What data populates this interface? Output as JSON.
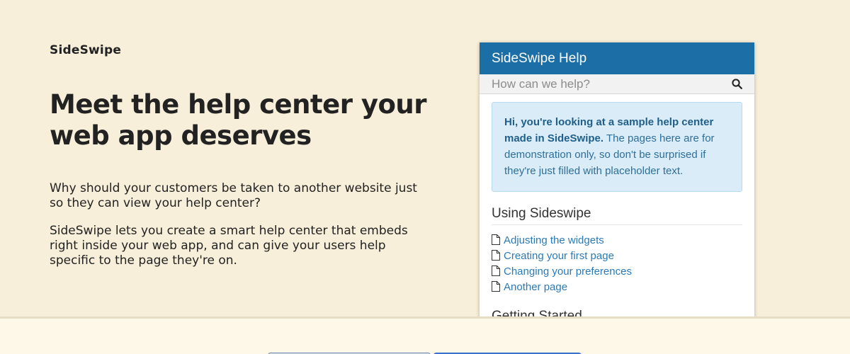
{
  "brand": "SideSwipe",
  "hero": {
    "title": "Meet the help center your web app deserves",
    "paragraph1": "Why should your customers be taken to another website just so they can view your help center?",
    "paragraph2": "SideSwipe lets you create a smart help center that embeds right inside your web app, and can give your users help specific to the page they're on."
  },
  "help_widget": {
    "title": "SideSwipe Help",
    "search_placeholder": "How can we help?",
    "search_icon": "search-icon",
    "notice_bold": "Hi, you're looking at a sample help center made in SideSwipe.",
    "notice_rest": " The pages here are for demonstration only, so don't be surprised if they're just filled with placeholder text.",
    "section1_title": "Using Sideswipe",
    "pages": [
      {
        "label": "Adjusting the widgets",
        "icon": "document-icon"
      },
      {
        "label": "Creating your first page",
        "icon": "document-icon"
      },
      {
        "label": "Changing your preferences",
        "icon": "document-icon"
      },
      {
        "label": "Another page",
        "icon": "document-icon"
      }
    ],
    "section2_title": "Getting Started"
  },
  "colors": {
    "page_background": "#f7efd9",
    "widget_header": "#1c6ea7",
    "notice_background": "#d9ecf8",
    "link": "#2a7ab8",
    "primary_button": "#3b6fce"
  }
}
